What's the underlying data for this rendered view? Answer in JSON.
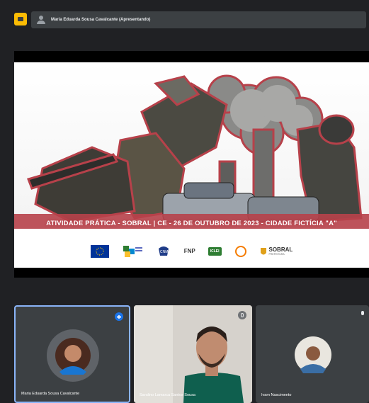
{
  "presenting": {
    "label": "Maria Eduarda Sousa Cavalcante (Apresentando)"
  },
  "slide": {
    "caption": "ATIVIDADE PRÁTICA - SOBRAL | CE - 26 DE OUTUBRO DE 2023 - CIDADE FICTÍCIA \"A\"",
    "logos": {
      "eu": "Financiado pela União Europeia",
      "fnp": "FNP",
      "iclei": "ICLEI",
      "sobral": "SOBRAL",
      "sobral_sub": "PREFEITURA"
    }
  },
  "participants": [
    {
      "name": "Maria Eduarda Sousa Cavalcante"
    },
    {
      "name": "Sandino Lamarca Santos Sousa"
    },
    {
      "name": "Ivam Nascimento"
    }
  ],
  "colors": {
    "accent": "#8ab4f8",
    "speaking": "#1a73e8",
    "tile": "#3c4043",
    "slide_red": "#b7414a"
  }
}
